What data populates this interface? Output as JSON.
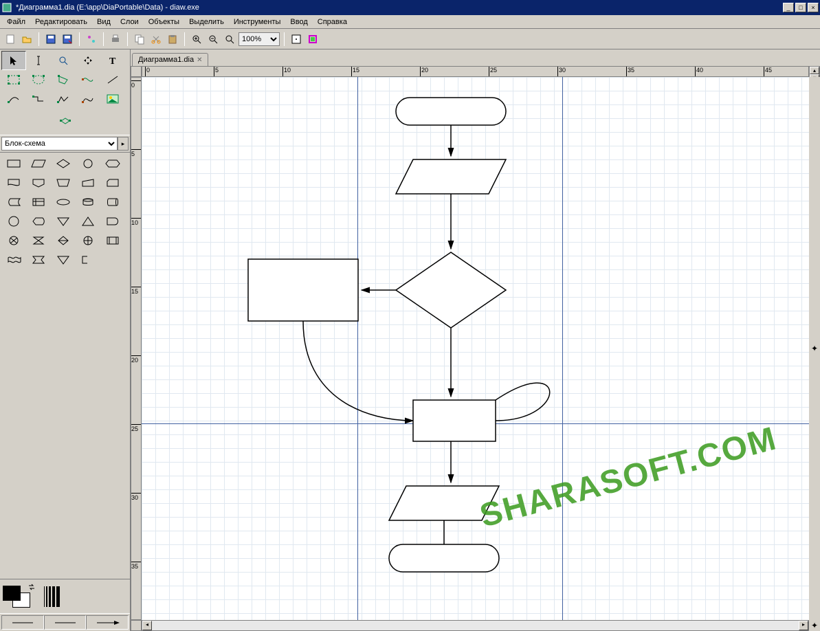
{
  "window": {
    "title": "*Диаграмма1.dia (E:\\app\\DiaPortable\\Data) - diaw.exe"
  },
  "menu": {
    "file": "Файл",
    "edit": "Редактировать",
    "view": "Вид",
    "layers": "Слои",
    "objects": "Объекты",
    "select": "Выделить",
    "tools": "Инструменты",
    "input": "Ввод",
    "help": "Справка"
  },
  "toolbar": {
    "zoom_value": "100%"
  },
  "tab": {
    "label": "Диаграмма1.dia"
  },
  "stencil": {
    "category": "Блок-схема"
  },
  "ruler": {
    "h": [
      "0",
      "5",
      "10",
      "15",
      "20",
      "25",
      "30",
      "35",
      "40",
      "45"
    ],
    "v": [
      "0",
      "5",
      "10",
      "15",
      "20",
      "25",
      "30",
      "35"
    ]
  },
  "watermark": "SHARASOFT.COM"
}
